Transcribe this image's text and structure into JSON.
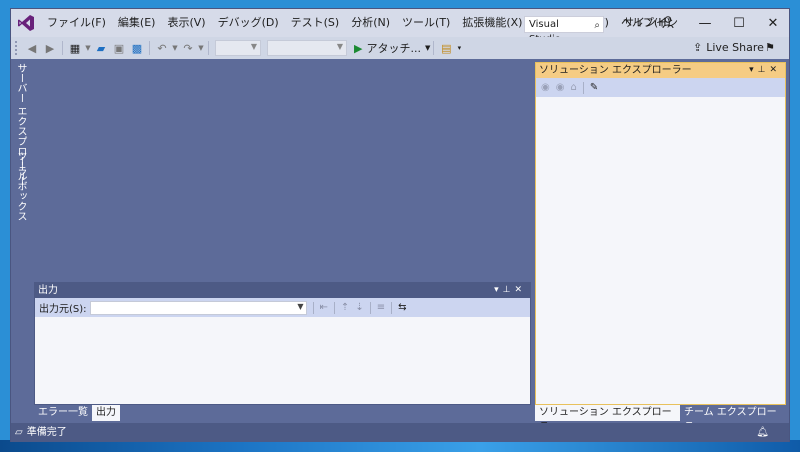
{
  "menu": {
    "items": [
      "ファイル(F)",
      "編集(E)",
      "表示(V)",
      "デバッグ(D)",
      "テスト(S)",
      "分析(N)",
      "ツール(T)",
      "拡張機能(X)",
      "ウィンドウ(W)",
      "ヘルプ(H)"
    ]
  },
  "search": {
    "value": "Visual Studio...",
    "icon": "search-icon"
  },
  "account": {
    "signin_label": "サインイン"
  },
  "toolbar": {
    "attach_label": "アタッチ...",
    "liveshare_label": "Live Share"
  },
  "side_tabs": {
    "server_explorer": "サーバー エクスプローラー",
    "toolbox": "ツールボックス"
  },
  "output_panel": {
    "title": "出力",
    "source_label": "出力元(S):",
    "source_value": ""
  },
  "bottom_tabs_left": [
    "エラー一覧",
    "出力"
  ],
  "solution_panel": {
    "title": "ソリューション エクスプローラー"
  },
  "bottom_tabs_right": [
    "ソリューション エクスプローラー",
    "チーム エクスプローラー"
  ],
  "status": {
    "text": "準備完了"
  },
  "colors": {
    "accent": "#68217a",
    "titlebar": "#d6dbe9",
    "workspace": "#5d6b99",
    "panel_header": "#4d5a85",
    "active_panel_header": "#f5cc84"
  }
}
